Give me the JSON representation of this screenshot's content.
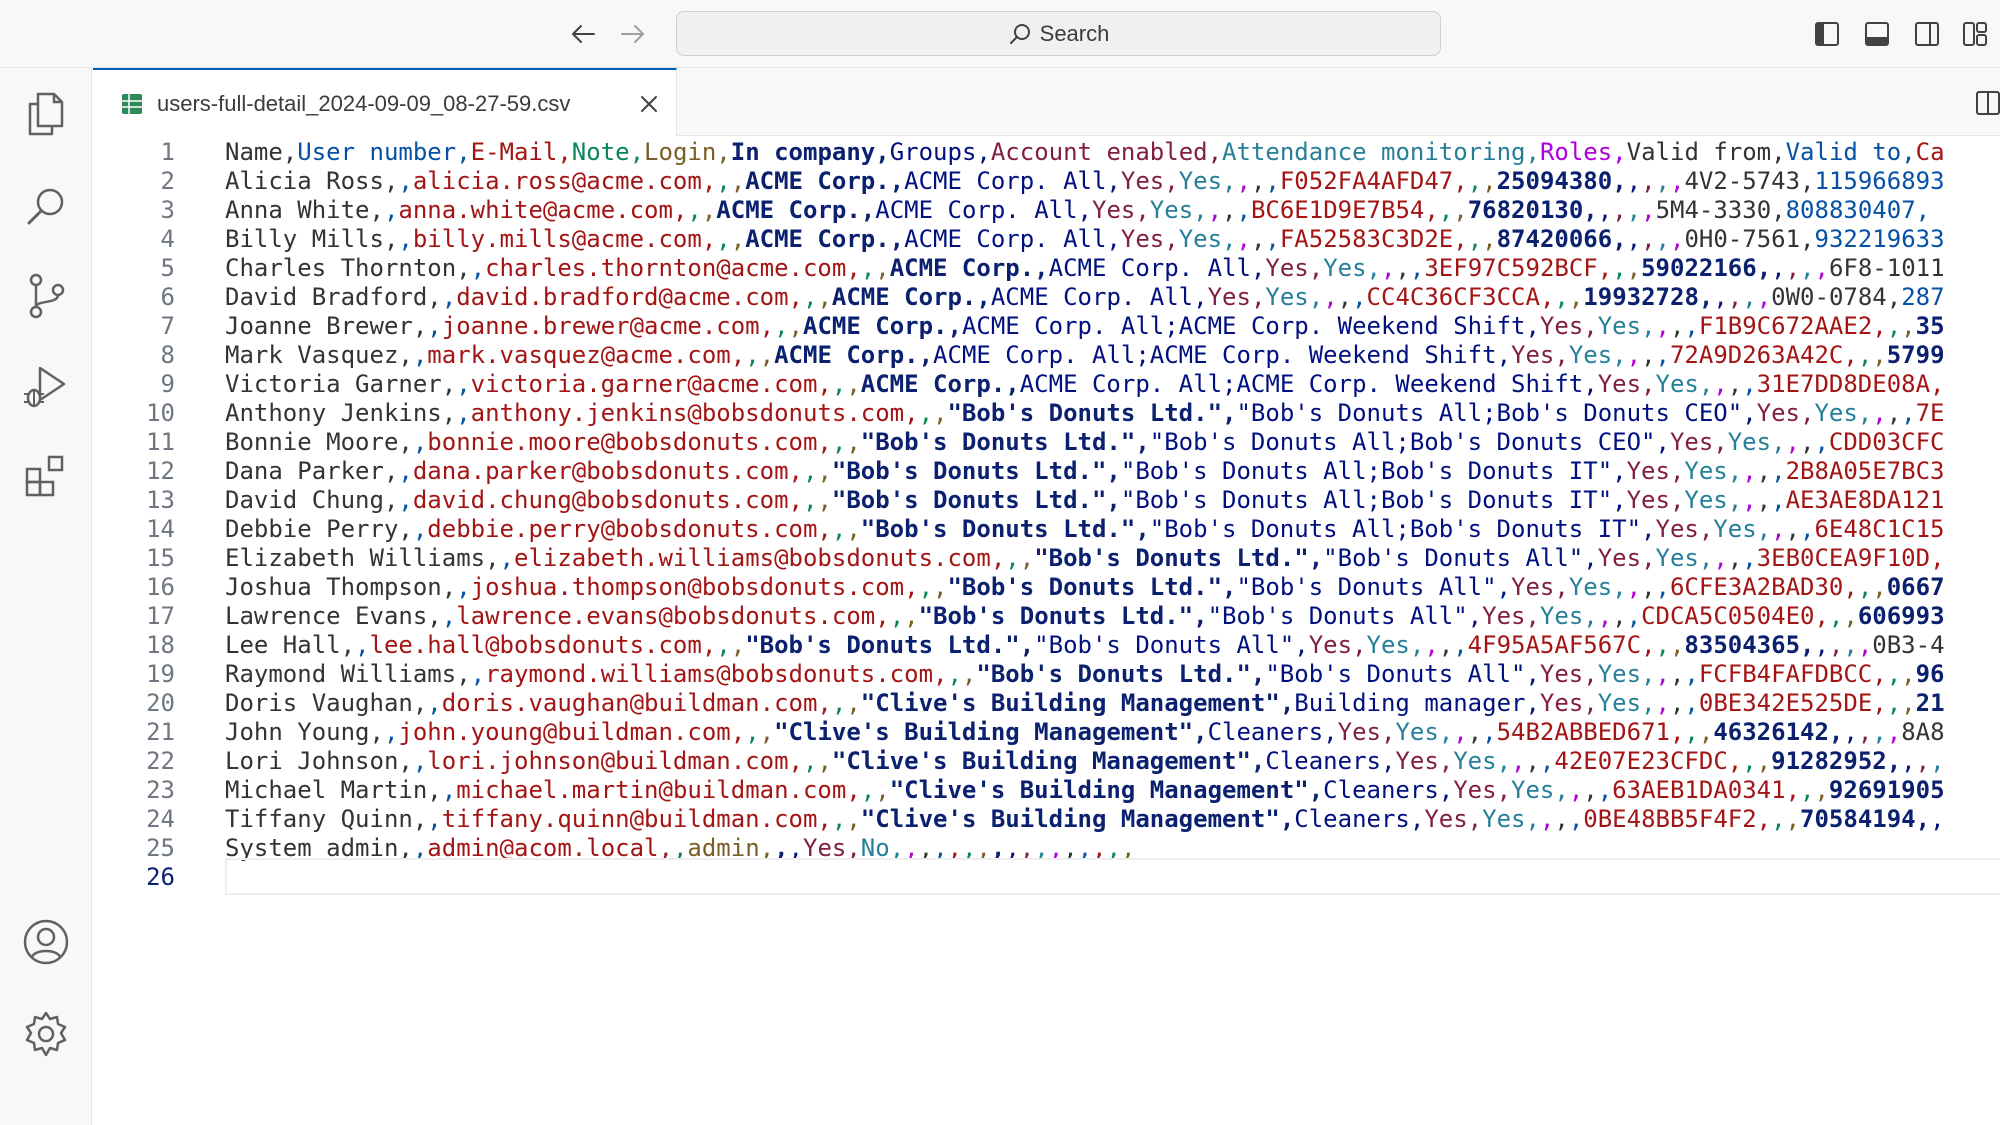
{
  "titlebar": {
    "search_label": "Search"
  },
  "tab": {
    "title": "users-full-detail_2024-09-09_08-27-59.csv"
  },
  "colors": {
    "accent": "#005fb8",
    "csv_icon": "#2e8b57",
    "column_palette": [
      "#333333",
      "#0451a5",
      "#a31515",
      "#098658",
      "#795e26",
      "#0b216f",
      "#001080",
      "#811f3f",
      "#267f99",
      "#af00db"
    ]
  },
  "cursor_line": 26,
  "lines": [
    "Name,User number,E-Mail,Note,Login,In company,Groups,Account enabled,Attendance monitoring,Roles,Valid from,Valid to,Ca",
    "Alicia Ross,,alicia.ross@acme.com,,,ACME Corp.,ACME Corp. All,Yes,Yes,,,,F052FA4AFD47,,,25094380,,,,,4V2-5743,115966893",
    "Anna White,,anna.white@acme.com,,,ACME Corp.,ACME Corp. All,Yes,Yes,,,,BC6E1D9E7B54,,,76820130,,,,,5M4-3330,808830407,",
    "Billy Mills,,billy.mills@acme.com,,,ACME Corp.,ACME Corp. All,Yes,Yes,,,,FA52583C3D2E,,,87420066,,,,,0H0-7561,932219633",
    "Charles Thornton,,charles.thornton@acme.com,,,ACME Corp.,ACME Corp. All,Yes,Yes,,,,3EF97C592BCF,,,59022166,,,,,6F8-1011",
    "David Bradford,,david.bradford@acme.com,,,ACME Corp.,ACME Corp. All,Yes,Yes,,,,CC4C36CF3CCA,,,19932728,,,,,0W0-0784,287",
    "Joanne Brewer,,joanne.brewer@acme.com,,,ACME Corp.,ACME Corp. All;ACME Corp. Weekend Shift,Yes,Yes,,,,F1B9C672AAE2,,,35",
    "Mark Vasquez,,mark.vasquez@acme.com,,,ACME Corp.,ACME Corp. All;ACME Corp. Weekend Shift,Yes,Yes,,,,72A9D263A42C,,,5799",
    "Victoria Garner,,victoria.garner@acme.com,,,ACME Corp.,ACME Corp. All;ACME Corp. Weekend Shift,Yes,Yes,,,,31E7DD8DE08A,",
    "Anthony Jenkins,,anthony.jenkins@bobsdonuts.com,,,\"Bob's Donuts Ltd.\",\"Bob's Donuts All;Bob's Donuts CEO\",Yes,Yes,,,,7E",
    "Bonnie Moore,,bonnie.moore@bobsdonuts.com,,,\"Bob's Donuts Ltd.\",\"Bob's Donuts All;Bob's Donuts CEO\",Yes,Yes,,,,CDD03CFC",
    "Dana Parker,,dana.parker@bobsdonuts.com,,,\"Bob's Donuts Ltd.\",\"Bob's Donuts All;Bob's Donuts IT\",Yes,Yes,,,,2B8A05E7BC3",
    "David Chung,,david.chung@bobsdonuts.com,,,\"Bob's Donuts Ltd.\",\"Bob's Donuts All;Bob's Donuts IT\",Yes,Yes,,,,AE3AE8DA121",
    "Debbie Perry,,debbie.perry@bobsdonuts.com,,,\"Bob's Donuts Ltd.\",\"Bob's Donuts All;Bob's Donuts IT\",Yes,Yes,,,,6E48C1C15",
    "Elizabeth Williams,,elizabeth.williams@bobsdonuts.com,,,\"Bob's Donuts Ltd.\",\"Bob's Donuts All\",Yes,Yes,,,,3EB0CEA9F10D,",
    "Joshua Thompson,,joshua.thompson@bobsdonuts.com,,,\"Bob's Donuts Ltd.\",\"Bob's Donuts All\",Yes,Yes,,,,6CFE3A2BAD30,,,0667",
    "Lawrence Evans,,lawrence.evans@bobsdonuts.com,,,\"Bob's Donuts Ltd.\",\"Bob's Donuts All\",Yes,Yes,,,,CDCA5C0504E0,,,606993",
    "Lee Hall,,lee.hall@bobsdonuts.com,,,\"Bob's Donuts Ltd.\",\"Bob's Donuts All\",Yes,Yes,,,,4F95A5AF567C,,,83504365,,,,,0B3-4",
    "Raymond Williams,,raymond.williams@bobsdonuts.com,,,\"Bob's Donuts Ltd.\",\"Bob's Donuts All\",Yes,Yes,,,,FCFB4FAFDBCC,,,96",
    "Doris Vaughan,,doris.vaughan@buildman.com,,,\"Clive's Building Management\",Building manager,Yes,Yes,,,,0BE342E525DE,,,21",
    "John Young,,john.young@buildman.com,,,\"Clive's Building Management\",Cleaners,Yes,Yes,,,,54B2ABBED671,,,46326142,,,,,8A8",
    "Lori Johnson,,lori.johnson@buildman.com,,,\"Clive's Building Management\",Cleaners,Yes,Yes,,,,42E07E23CFDC,,,91282952,,,,",
    "Michael Martin,,michael.martin@buildman.com,,,\"Clive's Building Management\",Cleaners,Yes,Yes,,,,63AEB1DA0341,,,92691905",
    "Tiffany Quinn,,tiffany.quinn@buildman.com,,,\"Clive's Building Management\",Cleaners,Yes,Yes,,,,0BE48BB5F4F2,,,70584194,,",
    "System admin,,admin@acom.local,,admin,,,Yes,No,,,,,,,,,,,,,,,,,",
    ""
  ]
}
